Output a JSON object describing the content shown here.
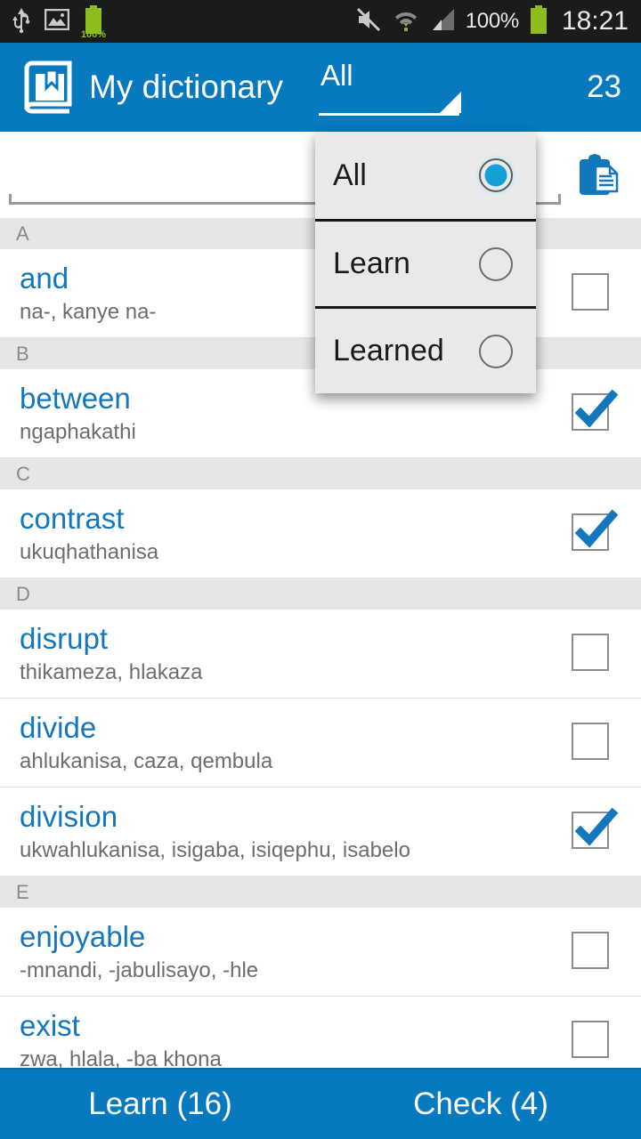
{
  "status_bar": {
    "icons_left": [
      "usb-icon",
      "screenshot-image-icon",
      "battery-icon"
    ],
    "battery_left_label": "100%",
    "icons_right": [
      "mute-icon",
      "wifi-icon",
      "signal-icon",
      "battery-icon"
    ],
    "battery_percent": "100%",
    "clock": "18:21"
  },
  "action_bar": {
    "logo_icon": "book-bookmark-icon",
    "title": "My dictionary",
    "spinner_value": "All",
    "spinner_caret_icon": "spinner-caret-icon",
    "word_count": "23",
    "background_color": "#0779bf"
  },
  "search": {
    "value": "",
    "placeholder": "",
    "clipboard_icon": "clipboard-icon"
  },
  "dropdown": {
    "open": true,
    "selected": "All",
    "options": [
      {
        "label": "All",
        "selected": true
      },
      {
        "label": "Learn",
        "selected": false
      },
      {
        "label": "Learned",
        "selected": false
      }
    ]
  },
  "list": {
    "sections": [
      {
        "letter": "A",
        "words": [
          {
            "term": "and",
            "translation": "na-, kanye na-",
            "checked": false
          }
        ]
      },
      {
        "letter": "B",
        "words": [
          {
            "term": "between",
            "translation": "ngaphakathi",
            "checked": true
          }
        ]
      },
      {
        "letter": "C",
        "words": [
          {
            "term": "contrast",
            "translation": "ukuqhathanisa",
            "checked": true
          }
        ]
      },
      {
        "letter": "D",
        "words": [
          {
            "term": "disrupt",
            "translation": "thikameza, hlakaza",
            "checked": false
          },
          {
            "term": "divide",
            "translation": "ahlukanisa, caza, qembula",
            "checked": false
          },
          {
            "term": "division",
            "translation": "ukwahlukanisa, isigaba, isiqephu, isabelo",
            "checked": true
          }
        ]
      },
      {
        "letter": "E",
        "words": [
          {
            "term": "enjoyable",
            "translation": "-mnandi, -jabulisayo, -hle",
            "checked": false
          },
          {
            "term": "exist",
            "translation": "zwa, hlala, -ba khona",
            "checked": false
          }
        ]
      }
    ]
  },
  "bottom_bar": {
    "learn_label": "Learn (16)",
    "check_label": "Check (4)"
  },
  "colors": {
    "accent": "#0779bf",
    "term": "#1277bc",
    "section_bg": "#e6e6e6",
    "status_bg": "#1b1b1b"
  }
}
